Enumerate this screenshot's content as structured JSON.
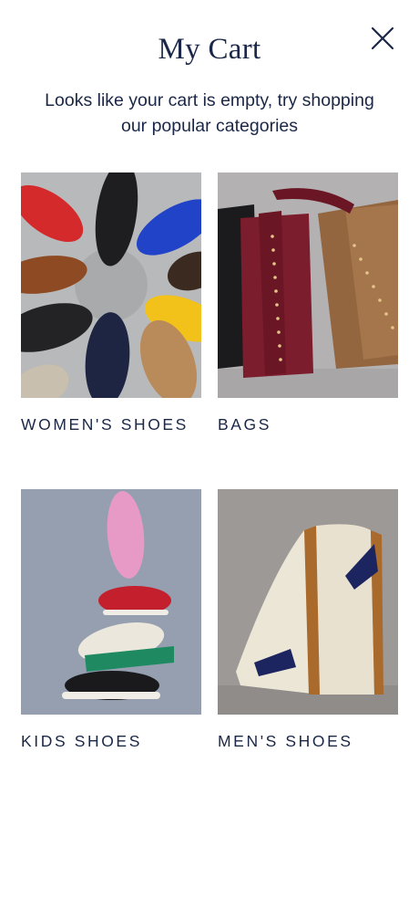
{
  "header": {
    "title": "My Cart",
    "close_icon": "close-icon"
  },
  "empty_message": "Looks like your cart is empty, try shopping our popular categories",
  "categories": [
    {
      "label": "WOMEN'S SHOES",
      "image": "womens-shoes-photo"
    },
    {
      "label": "BAGS",
      "image": "bags-photo"
    },
    {
      "label": "KIDS SHOES",
      "image": "kids-shoes-photo"
    },
    {
      "label": "MEN'S SHOES",
      "image": "mens-shoes-photo"
    }
  ],
  "colors": {
    "text": "#1b2747",
    "background": "#ffffff"
  }
}
